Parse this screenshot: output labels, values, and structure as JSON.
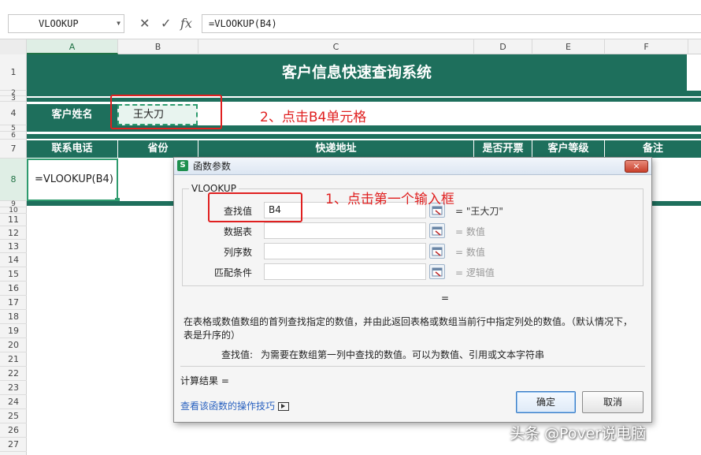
{
  "formula_bar": {
    "name_box": "VLOOKUP",
    "cancel_icon": "close-icon",
    "confirm_icon": "check-icon",
    "fx_label": "fx",
    "formula": "=VLOOKUP(B4)"
  },
  "columns": [
    "A",
    "B",
    "C",
    "D",
    "E",
    "F"
  ],
  "rows": [
    "1",
    "2",
    "3",
    "4",
    "5",
    "6",
    "7",
    "8",
    "9",
    "10",
    "11",
    "12",
    "13",
    "14",
    "15",
    "16",
    "17",
    "18",
    "19",
    "20",
    "21",
    "22",
    "23",
    "24",
    "25",
    "26",
    "27"
  ],
  "sheet": {
    "title": "客户信息快速查询系统",
    "customer_name_label": "客户姓名",
    "customer_name_value": "王大刀",
    "headers": [
      "联系电话",
      "省份",
      "快递地址",
      "是否开票",
      "客户等级",
      "备注"
    ],
    "a8_formula": "=VLOOKUP(B4)"
  },
  "annotations": {
    "step1": "1、点击第一个输入框",
    "step2": "2、点击B4单元格"
  },
  "dialog": {
    "title": "函数参数",
    "function_name": "VLOOKUP",
    "args": [
      {
        "label": "查找值",
        "value": "B4",
        "result": "= \"王大刀\""
      },
      {
        "label": "数据表",
        "value": "",
        "result": "= 数值"
      },
      {
        "label": "列序数",
        "value": "",
        "result": "= 数值"
      },
      {
        "label": "匹配条件",
        "value": "",
        "result": "= 逻辑值"
      }
    ],
    "total_eq": "=",
    "description": "在表格或数值数组的首列查找指定的数值，并由此返回表格或数组当前行中指定列处的数值。（默认情况下，",
    "description2": "表是升序的）",
    "arg_help_label": "查找值:",
    "arg_help": "为需要在数组第一列中查找的数值。可以为数值、引用或文本字符串",
    "calc_result": "计算结果 =",
    "help_link": "查看该函数的操作技巧",
    "ok": "确定",
    "cancel": "取消",
    "close": "×"
  },
  "watermark": "头条 @Pover说电脑",
  "colors": {
    "header_green": "#1e6f5c",
    "annotation_red": "#e02020",
    "selection_green": "#2e9b6e"
  }
}
